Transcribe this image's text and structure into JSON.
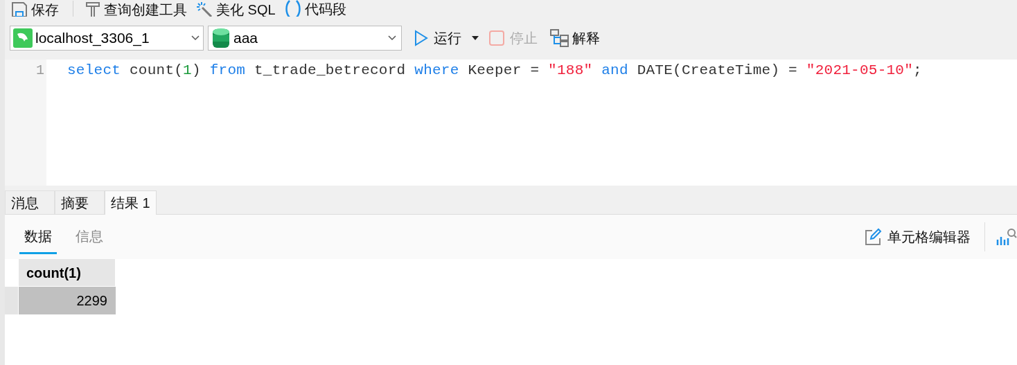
{
  "toolbar": [
    {
      "kind": "save",
      "label": "保存"
    },
    {
      "kind": "builder",
      "label": "查询创建工具"
    },
    {
      "kind": "beautify",
      "label": "美化 SQL"
    },
    {
      "kind": "snippet",
      "label": "代码段"
    }
  ],
  "connection": {
    "value": "localhost_3306_1"
  },
  "database": {
    "value": "aaa"
  },
  "run": {
    "label": "运行"
  },
  "stop": {
    "label": "停止",
    "disabled": true
  },
  "explain": {
    "label": "解释"
  },
  "editor": {
    "lines": [
      {
        "number": "1",
        "tokens": [
          {
            "kind": "keyword",
            "text": "select"
          },
          {
            "kind": "plain",
            "text": " count("
          },
          {
            "kind": "number",
            "text": "1"
          },
          {
            "kind": "plain",
            "text": ") "
          },
          {
            "kind": "keyword",
            "text": "from"
          },
          {
            "kind": "plain",
            "text": " t_trade_betrecord "
          },
          {
            "kind": "keyword",
            "text": "where"
          },
          {
            "kind": "plain",
            "text": " Keeper = "
          },
          {
            "kind": "string",
            "text": "\"188\""
          },
          {
            "kind": "keyword",
            "text": " and"
          },
          {
            "kind": "plain",
            "text": " DATE(CreateTime) = "
          },
          {
            "kind": "string",
            "text": "\"2021-05-10\""
          },
          {
            "kind": "plain",
            "text": ";"
          }
        ]
      }
    ]
  },
  "result_tabs": [
    {
      "label": "消息",
      "selected": false
    },
    {
      "label": "摘要",
      "selected": false
    },
    {
      "label": "结果 1",
      "selected": true
    }
  ],
  "sub_tabs": [
    {
      "label": "数据",
      "selected": true
    },
    {
      "label": "信息",
      "selected": false
    }
  ],
  "cell_editor": {
    "label": "单元格编辑器"
  },
  "table": {
    "columns": [
      "count(1)"
    ],
    "rows": [
      {
        "cells": [
          "2299"
        ],
        "selected": true
      }
    ]
  }
}
